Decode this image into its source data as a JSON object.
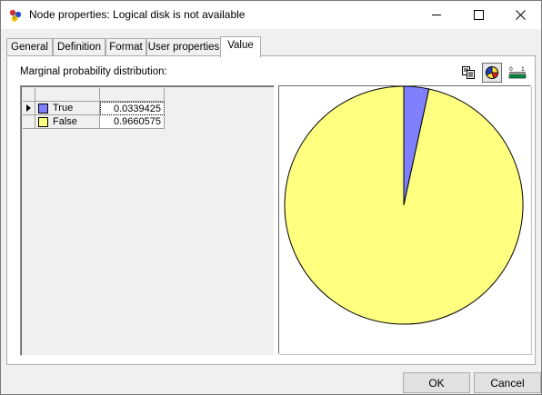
{
  "window": {
    "title": "Node properties: Logical disk is not available"
  },
  "tabs": [
    {
      "label": "General",
      "active": false
    },
    {
      "label": "Definition",
      "active": false
    },
    {
      "label": "Format",
      "active": false
    },
    {
      "label": "User properties",
      "active": false
    },
    {
      "label": "Value",
      "active": true
    }
  ],
  "value_page": {
    "section_label": "Marginal probability distribution:",
    "toolbar": [
      {
        "icon": "copy-icon",
        "pressed": false
      },
      {
        "icon": "pie-chart-icon",
        "pressed": true
      },
      {
        "icon": "bar-chart-icon",
        "pressed": false
      }
    ],
    "states": [
      {
        "name": "True",
        "value": "0.0339425",
        "probability": 0.0339425,
        "color": "#8080ff",
        "selected": true
      },
      {
        "name": "False",
        "value": "0.9660575",
        "probability": 0.9660575,
        "color": "#ffff80",
        "selected": false
      }
    ]
  },
  "chart_data": {
    "type": "pie",
    "categories": [
      "True",
      "False"
    ],
    "values": [
      0.0339425,
      0.9660575
    ],
    "colors": [
      "#8080ff",
      "#ffff80"
    ]
  },
  "buttons": {
    "ok_label": "OK",
    "cancel_label": "Cancel"
  }
}
